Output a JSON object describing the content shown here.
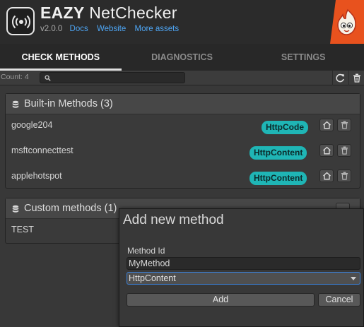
{
  "app": {
    "title_bold": "EAZY",
    "title_rest": "NetChecker",
    "version": "v2.0.0",
    "links": [
      "Docs",
      "Website",
      "More assets"
    ]
  },
  "tabs": [
    "CHECK METHODS",
    "DIAGNOSTICS",
    "SETTINGS"
  ],
  "active_tab": "CHECK METHODS",
  "toolbar": {
    "count_label": "Count: 4",
    "search_value": ""
  },
  "builtin": {
    "title": "Built-in Methods (3)",
    "rows": [
      {
        "name": "google204",
        "type": "HttpCode"
      },
      {
        "name": "msftconnecttest",
        "type": "HttpContent"
      },
      {
        "name": "applehotspot",
        "type": "HttpContent"
      }
    ]
  },
  "custom": {
    "title": "Custom methods (1)",
    "rows": [
      {
        "name": "TEST"
      }
    ]
  },
  "dialog": {
    "title": "Add new method",
    "method_id_label": "Method Id",
    "method_id_value": "MyMethod",
    "type_selected": "HttpContent",
    "add_label": "Add",
    "cancel_label": "Cancel"
  },
  "colors": {
    "accent_link": "#4ea6f5",
    "badge": "#1fb5b5",
    "select_border": "#3a7fd6",
    "corner_orange": "#e8521e"
  },
  "icons": [
    "wifi-icon",
    "flame-mascot-icon",
    "search-icon",
    "refresh-icon",
    "trash-icon",
    "database-icon",
    "home-icon",
    "chevron-down-icon"
  ]
}
